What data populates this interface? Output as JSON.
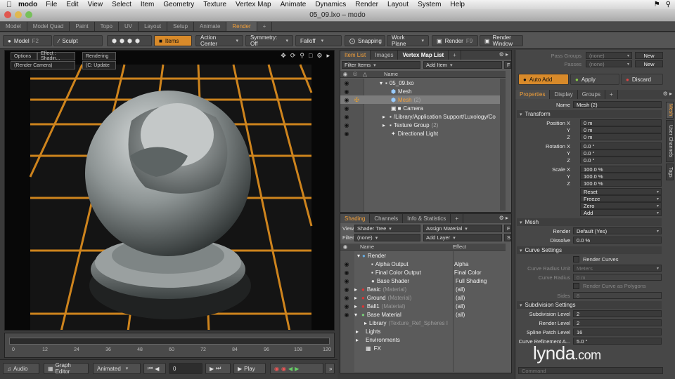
{
  "menubar": {
    "app_name": "modo",
    "items": [
      "File",
      "Edit",
      "View",
      "Select",
      "Item",
      "Geometry",
      "Texture",
      "Vertex Map",
      "Animate",
      "Dynamics",
      "Render",
      "Layout",
      "System",
      "Help"
    ]
  },
  "window": {
    "title": "05_09.lxo – modo"
  },
  "layout_tabs": [
    "Model",
    "Model Quad",
    "Paint",
    "Topo",
    "UV",
    "Layout",
    "Setup",
    "Animate",
    "Render",
    "+"
  ],
  "layout_tabs_active": "Render",
  "toolbar": {
    "model": "Model",
    "model_key": "F2",
    "sculpt": "Sculpt",
    "items": "Items",
    "action_center": "Action Center",
    "symmetry": "Symmetry: Off",
    "falloff": "Falloff",
    "snapping": "Snapping",
    "work_plane": "Work Plane",
    "render": "Render",
    "render_key": "F9",
    "render_window": "Render Window"
  },
  "viewport": {
    "labels": [
      "Options",
      "Effect : Shadin...",
      "Rendering",
      "(Render Camera)",
      "(C: Update"
    ]
  },
  "timeline": {
    "ticks": [
      "0",
      "12",
      "24",
      "36",
      "48",
      "60",
      "72",
      "84",
      "96",
      "108",
      "120"
    ],
    "bottom_ticks": [
      "0",
      "",
      "",
      "",
      "",
      "",
      "",
      "",
      "",
      "",
      "120"
    ]
  },
  "bottombar": {
    "audio": "Audio",
    "graph_editor": "Graph Editor",
    "animated": "Animated",
    "frame": "0",
    "play": "Play"
  },
  "item_panel": {
    "tabs": [
      "Item List",
      "Images",
      "Vertex Map List",
      "+"
    ],
    "filter": "Filter Items",
    "add_item": "Add Item",
    "add_key": "F",
    "column": "Name",
    "rows": [
      {
        "label": "05_09.lxo",
        "sub": ""
      },
      {
        "label": "Mesh",
        "sub": ""
      },
      {
        "label": "Mesh",
        "sub": "(2)"
      },
      {
        "label": "Camera",
        "sub": ""
      },
      {
        "label": "/Library/Application Support/Luxology/Co",
        "sub": ""
      },
      {
        "label": "Texture Group",
        "sub": "(2)"
      },
      {
        "label": "Directional Light",
        "sub": ""
      }
    ]
  },
  "shade_panel": {
    "tabs": [
      "Shading",
      "Channels",
      "Info & Statistics",
      "+"
    ],
    "view_label": "View",
    "view": "Shader Tree",
    "assign": "Assign Material",
    "assign_key": "F",
    "filter_label": "Filter",
    "filter": "(none)",
    "add_layer": "Add Layer",
    "add_layer_key": "S",
    "col_name": "Name",
    "col_effect": "Effect",
    "rows": [
      {
        "name": "Render",
        "sub": "",
        "effect": ""
      },
      {
        "name": "Alpha Output",
        "sub": "",
        "effect": "Alpha"
      },
      {
        "name": "Final Color Output",
        "sub": "",
        "effect": "Final Color"
      },
      {
        "name": "Base Shader",
        "sub": "",
        "effect": "Full Shading"
      },
      {
        "name": "Basic",
        "sub": "(Material)",
        "effect": "(all)"
      },
      {
        "name": "Ground",
        "sub": "(Material)",
        "effect": "(all)"
      },
      {
        "name": "Ball1",
        "sub": "(Material)",
        "effect": "(all)"
      },
      {
        "name": "Base Material",
        "sub": "",
        "effect": "(all)"
      },
      {
        "name": "Library",
        "sub": "(Texture_Ref_Spheres I",
        "effect": ""
      },
      {
        "name": "Lights",
        "sub": "",
        "effect": ""
      },
      {
        "name": "Environments",
        "sub": "",
        "effect": ""
      },
      {
        "name": "FX",
        "sub": "",
        "effect": ""
      }
    ]
  },
  "right_panel": {
    "pass_groups": "Pass Groups",
    "pass_groups_val": "(none)",
    "passes": "Passes",
    "passes_val": "(none)",
    "new": "New",
    "auto_add": "Auto Add",
    "apply": "Apply",
    "discard": "Discard",
    "tabs": [
      "Properties",
      "Display",
      "Groups",
      "+"
    ],
    "name_label": "Name",
    "name_value": "Mesh (2)",
    "transform": "Transform",
    "pos_label": "Position X",
    "pos": [
      "0 m",
      "0 m",
      "0 m"
    ],
    "rot_label": "Rotation X",
    "rot": [
      "0.0 °",
      "0.0 °",
      "0.0 °"
    ],
    "scale_label": "Scale X",
    "scale": [
      "100.0 %",
      "100.0 %",
      "100.0 %"
    ],
    "yz": [
      "Y",
      "Z"
    ],
    "actions": [
      "Reset",
      "Freeze",
      "Zero",
      "Add"
    ],
    "mesh_section": "Mesh",
    "render_label": "Render",
    "render_val": "Default (Yes)",
    "dissolve_label": "Dissolve",
    "dissolve_val": "0.0 %",
    "curve_section": "Curve Settings",
    "render_curves": "Render Curves",
    "curve_radius_unit": "Curve Radius Unit",
    "curve_radius_unit_val": "Meters",
    "curve_radius": "Curve Radius",
    "curve_radius_val": "0 m",
    "render_poly": "Render Curve as Polygons",
    "sides": "Sides",
    "sides_val": "8",
    "subdiv_section": "Subdivision Settings",
    "subdiv_level": "Subdivision Level",
    "subdiv_level_val": "2",
    "render_level": "Render Level",
    "render_level_val": "2",
    "spline_patch": "Spline Patch Level",
    "spline_patch_val": "16",
    "curve_ref": "Curve Refinement A...",
    "curve_ref_val": "5.0 °",
    "command": "Command",
    "vtabs": [
      "Mesh",
      "User Channels",
      "Tags"
    ]
  },
  "watermark": {
    "text": "lynda",
    "suffix": ".com"
  }
}
